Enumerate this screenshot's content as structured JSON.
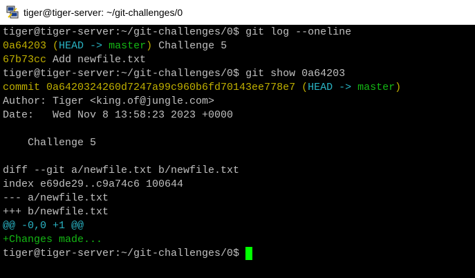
{
  "window": {
    "title": "tiger@tiger-server: ~/git-challenges/0",
    "icon": "putty-icon"
  },
  "terminal": {
    "prompt": "tiger@tiger-server:~/git-challenges/0$ ",
    "cmd1": "git log --oneline",
    "log1_hash": "0a64203",
    "log1_ref_open": "(",
    "log1_head": "HEAD ->",
    "log1_space": " ",
    "log1_branch": "master",
    "log1_ref_close": ")",
    "log1_msg": " Challenge 5",
    "log2_hash": "67b73cc",
    "log2_msg": " Add newfile.txt",
    "cmd2": "git show 0a64203",
    "commit_line": "commit 0a6420324260d7247a99c960b6fd70143ee778e7 ",
    "commit_ref_open": "(",
    "commit_head": "HEAD ->",
    "commit_space": " ",
    "commit_branch": "master",
    "commit_ref_close": ")",
    "author": "Author: Tiger <king.of@jungle.com>",
    "date": "Date:   Wed Nov 8 13:58:23 2023 +0000",
    "blank": "",
    "message": "    Challenge 5",
    "diff_header": "diff --git a/newfile.txt b/newfile.txt",
    "index_line": "index e69de29..c9a74c6 100644",
    "minus_file": "--- a/newfile.txt",
    "plus_file": "+++ b/newfile.txt",
    "hunk": "@@ -0,0 +1 @@",
    "added_line": "+Changes made...",
    "final_prompt": "tiger@tiger-server:~/git-challenges/0$ "
  },
  "colors": {
    "background": "#000000",
    "text": "#c0c0c0",
    "hash": "#c0b000",
    "head": "#2ab4c4",
    "branch": "#14b814",
    "cursor": "#00ff00"
  }
}
